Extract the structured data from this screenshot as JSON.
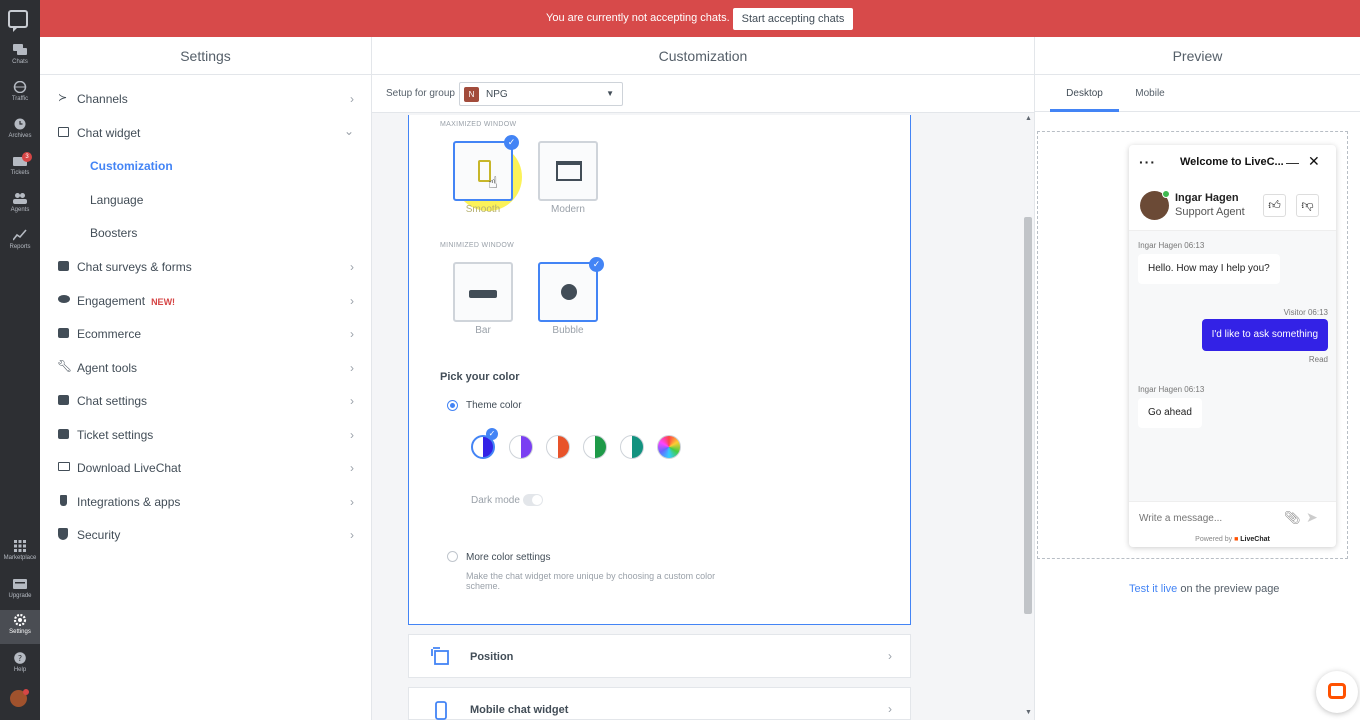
{
  "banner": {
    "message": "You are currently not accepting chats.",
    "button": "Start accepting chats"
  },
  "rail": {
    "items": [
      {
        "label": "Chats",
        "icon": "chat-bubbles-icon"
      },
      {
        "label": "Traffic",
        "icon": "globe-icon"
      },
      {
        "label": "Archives",
        "icon": "clock-icon"
      },
      {
        "label": "Tickets",
        "icon": "ticket-icon",
        "badge": "3"
      },
      {
        "label": "Agents",
        "icon": "people-icon"
      },
      {
        "label": "Reports",
        "icon": "chart-line-icon"
      },
      {
        "label": "Marketplace",
        "icon": "grid-icon"
      },
      {
        "label": "Upgrade",
        "icon": "upgrade-icon"
      },
      {
        "label": "Settings",
        "icon": "gear-icon"
      },
      {
        "label": "Help",
        "icon": "help-icon"
      }
    ]
  },
  "settings": {
    "title": "Settings",
    "nav": [
      {
        "label": "Channels",
        "icon": "channels-icon"
      },
      {
        "label": "Chat widget",
        "icon": "widget-icon"
      },
      {
        "label": "Chat surveys & forms",
        "icon": "survey-icon"
      },
      {
        "label": "Engagement",
        "icon": "eye-icon",
        "badge": "NEW!"
      },
      {
        "label": "Ecommerce",
        "icon": "cart-icon"
      },
      {
        "label": "Agent tools",
        "icon": "wrench-icon"
      },
      {
        "label": "Chat settings",
        "icon": "chat-settings-icon"
      },
      {
        "label": "Ticket settings",
        "icon": "ticket-settings-icon"
      },
      {
        "label": "Download LiveChat",
        "icon": "laptop-icon"
      },
      {
        "label": "Integrations & apps",
        "icon": "plug-icon"
      },
      {
        "label": "Security",
        "icon": "shield-icon"
      }
    ],
    "sub": [
      "Customization",
      "Language",
      "Boosters"
    ]
  },
  "customization": {
    "title": "Customization",
    "setup_label": "Setup for group",
    "group_initial": "N",
    "group_name": "NPG",
    "maximized_label": "MAXIMIZED WINDOW",
    "minimized_label": "MINIMIZED WINDOW",
    "tiles": {
      "smooth": "Smooth",
      "modern": "Modern",
      "bar": "Bar",
      "bubble": "Bubble"
    },
    "pick_color": "Pick your color",
    "theme_color": "Theme color",
    "dark_mode": "Dark mode",
    "more_color": "More color settings",
    "more_color_desc": "Make the chat widget more unique by choosing a custom color scheme.",
    "swatches": [
      "#3322e6",
      "#7b3ff2",
      "#e8532a",
      "#1e9a48",
      "#12927f"
    ],
    "sections": [
      {
        "title": "Position",
        "icon": "position-icon"
      },
      {
        "title": "Mobile chat widget",
        "icon": "mobile-widget-icon"
      }
    ]
  },
  "preview": {
    "title": "Preview",
    "tabs": [
      "Desktop",
      "Mobile"
    ],
    "widget": {
      "title": "Welcome to LiveC...",
      "agent_name": "Ingar Hagen",
      "agent_role": "Support Agent",
      "messages": [
        {
          "meta": "Ingar Hagen 06:13",
          "text": "Hello. How may I help you?"
        },
        {
          "meta": "Visitor 06:13",
          "text": "I'd like to ask something",
          "status": "Read"
        },
        {
          "meta": "Ingar Hagen 06:13",
          "text": "Go ahead"
        }
      ],
      "input_placeholder": "Write a message...",
      "powered_by": "Powered by",
      "brand": "LiveChat"
    },
    "test_live_link": "Test it live",
    "test_live_rest": " on the preview page"
  }
}
